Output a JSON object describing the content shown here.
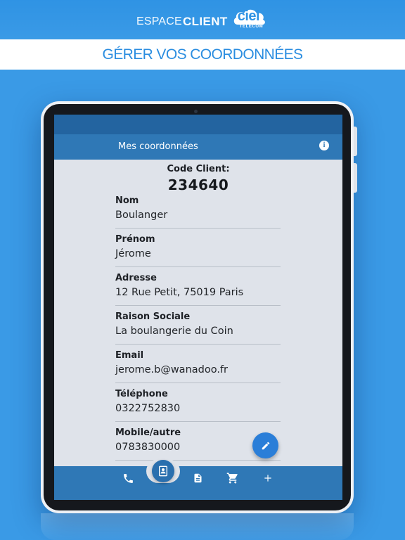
{
  "header": {
    "brand_light": "ESPACE",
    "brand_bold": "CLIENT",
    "logo_word": "ciel",
    "logo_sub": "TELECOM"
  },
  "banner": {
    "title": "GÉRER VOS COORDONNÉES"
  },
  "app": {
    "title": "Mes coordonnées",
    "info_icon": "info-icon",
    "code_label": "Code Client:",
    "code_value": "234640",
    "fields": [
      {
        "label": "Nom",
        "value": "Boulanger"
      },
      {
        "label": "Prénom",
        "value": "Jérome"
      },
      {
        "label": "Adresse",
        "value": "12 Rue Petit, 75019 Paris"
      },
      {
        "label": "Raison Sociale",
        "value": "La boulangerie du Coin"
      },
      {
        "label": "Email",
        "value": "jerome.b@wanadoo.fr"
      },
      {
        "label": "Téléphone",
        "value": "0322752830"
      },
      {
        "label": "Mobile/autre",
        "value": "0783830000"
      }
    ],
    "fab_icon": "edit-icon",
    "bottom_nav": [
      {
        "icon": "phone-icon"
      },
      {
        "icon": "contact-card-icon",
        "active": true
      },
      {
        "icon": "document-icon"
      },
      {
        "icon": "cart-icon"
      },
      {
        "icon": "plus-icon"
      }
    ]
  },
  "colors": {
    "background": "#3a9ae6",
    "appbar": "#2f78b6",
    "statusbar": "#2364a0",
    "fab": "#2a7ed8",
    "banner_text": "#2a8de0"
  }
}
